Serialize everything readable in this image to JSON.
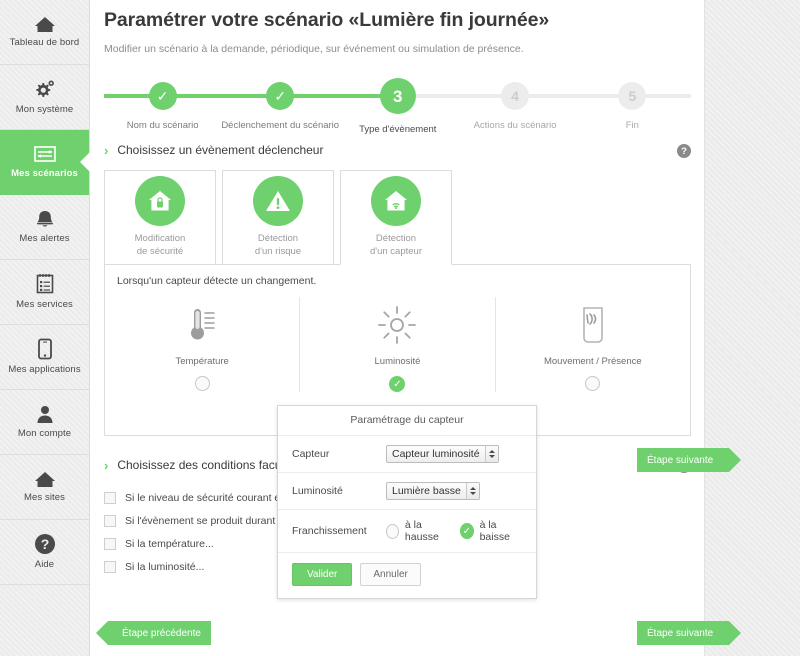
{
  "sidebar": {
    "items": [
      {
        "label": "Tableau de bord",
        "icon": "home-icon",
        "active": false
      },
      {
        "label": "Mon système",
        "icon": "gear-icon",
        "active": false
      },
      {
        "label": "Mes scénarios",
        "icon": "sliders-icon",
        "active": true
      },
      {
        "label": "Mes alertes",
        "icon": "bell-icon",
        "active": false
      },
      {
        "label": "Mes services",
        "icon": "clipboard-icon",
        "active": false
      },
      {
        "label": "Mes applications",
        "icon": "smartphone-icon",
        "active": false
      },
      {
        "label": "Mon compte",
        "icon": "user-icon",
        "active": false
      },
      {
        "label": "Mes sites",
        "icon": "home-icon",
        "active": false
      },
      {
        "label": "Aide",
        "icon": "question-circle-icon",
        "active": false
      }
    ]
  },
  "header": {
    "title": "Paramétrer votre scénario «Lumière fin journée»",
    "subtitle": "Modifier un scénario à la demande, périodique, sur événement ou simulation de présence."
  },
  "stepper": {
    "current_step": 3,
    "steps": [
      {
        "marker": "✓",
        "label": "Nom du scénario",
        "state": "done"
      },
      {
        "marker": "✓",
        "label": "Déclenchement du scénario",
        "state": "done"
      },
      {
        "marker": "3",
        "label": "Type d'évènement",
        "state": "current"
      },
      {
        "marker": "4",
        "label": "Actions du scénario",
        "state": "todo"
      },
      {
        "marker": "5",
        "label": "Fin",
        "state": "todo"
      }
    ]
  },
  "trigger_section": {
    "chevron": "›",
    "title": "Choisissez un évènement déclencheur",
    "help": "?",
    "tabs": [
      {
        "line1": "Modification",
        "line2": "de sécurité",
        "icon": "shield-home-icon",
        "active": false
      },
      {
        "line1": "Détection",
        "line2": "d'un risque",
        "icon": "warning-triangle-icon",
        "active": false
      },
      {
        "line1": "Détection",
        "line2": "d'un capteur",
        "icon": "sensor-home-icon",
        "active": true
      }
    ],
    "panel_hint": "Lorsqu'un capteur détecte un changement.",
    "sensors": [
      {
        "label": "Température",
        "icon": "thermometer-icon",
        "selected": false
      },
      {
        "label": "Luminosité",
        "icon": "sun-icon",
        "selected": true
      },
      {
        "label": "Mouvement / Présence",
        "icon": "motion-detector-icon",
        "selected": false
      }
    ]
  },
  "conditions_section": {
    "chevron": "›",
    "title": "Choisissez des conditions faculta",
    "help": "?",
    "items": [
      {
        "label": "Si le niveau de sécurité courant est...",
        "checked": false
      },
      {
        "label": "Si l'évènement se produit durant les pl",
        "checked": false
      },
      {
        "label": "Si la température...",
        "checked": false
      },
      {
        "label": "Si la luminosité...",
        "checked": false
      }
    ]
  },
  "modal": {
    "title": "Paramétrage du capteur",
    "rows": [
      {
        "label": "Capteur",
        "value": "Capteur luminosité"
      },
      {
        "label": "Luminosité",
        "value": "Lumière basse"
      }
    ],
    "crossing": {
      "label": "Franchissement",
      "options": [
        {
          "label": "à la hausse",
          "selected": false
        },
        {
          "label": "à la baisse",
          "selected": true
        }
      ]
    },
    "confirm_label": "Valider",
    "cancel_label": "Annuler"
  },
  "footer": {
    "next_label_top": "Étape suivante",
    "next_label_bottom": "Étape suivante",
    "prev_label": "Étape précédente"
  },
  "colors": {
    "accent_green": "#6ed16e",
    "text_dark": "#3a3a3a",
    "muted": "#9a9a9a",
    "page_bg": "#ebebeb"
  }
}
